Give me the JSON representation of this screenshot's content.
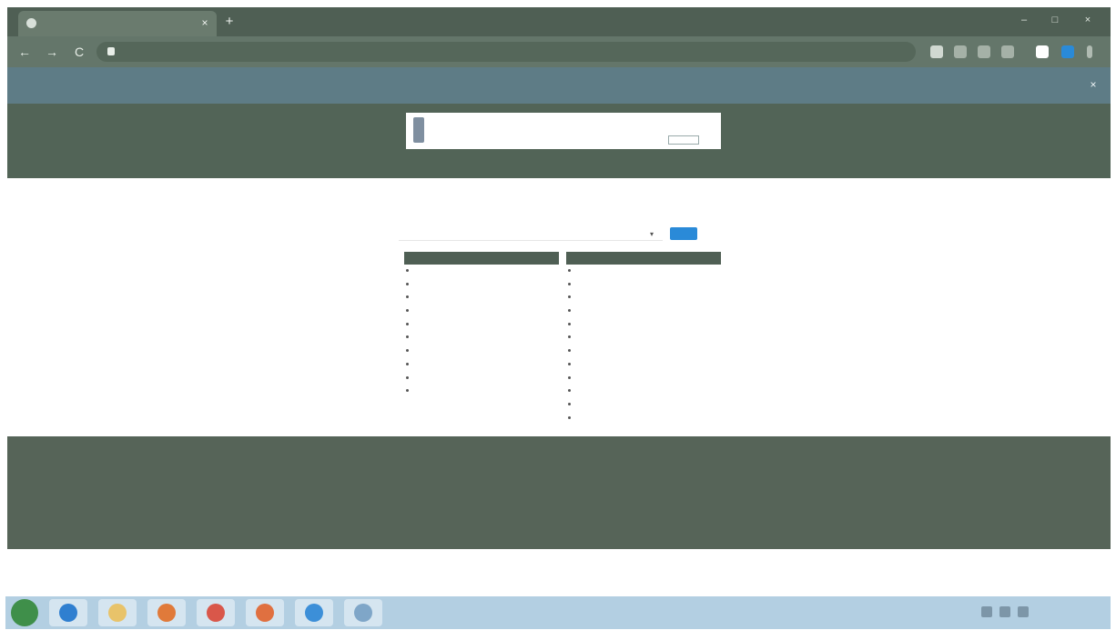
{
  "browser": {
    "tab_title": "",
    "tab_close": "×",
    "new_tab": "+",
    "window_controls": {
      "minimize": "–",
      "maximize": "□",
      "close": "×"
    },
    "nav": {
      "back": "←",
      "forward": "→",
      "reload": "C"
    },
    "url": "",
    "toolbar_icons": [
      "extension-icon",
      "star-icon",
      "extension-icon",
      "extension-icon",
      "extension-icon",
      "profile-icon",
      "menu-icon"
    ]
  },
  "infobar": {
    "message": "",
    "action_label": "",
    "close": "×"
  },
  "site": {
    "brand": "",
    "nav": [
      "",
      "",
      "",
      "",
      "",
      ""
    ],
    "breadcrumb_title": "",
    "breadcrumb_sub": ""
  },
  "content": {
    "heading": "",
    "subheading": "",
    "select_value": "",
    "caret": "▾",
    "go_label": ""
  },
  "panels": [
    {
      "header": "",
      "rows": [
        "",
        "",
        "",
        "",
        "",
        "",
        "",
        "",
        "",
        ""
      ]
    },
    {
      "header": "",
      "rows": [
        "",
        "",
        "",
        "",
        "",
        "",
        "",
        "",
        "",
        "",
        "",
        ""
      ]
    }
  ],
  "footer": {
    "columns": [
      {
        "heading": "",
        "items": [
          "",
          "",
          "",
          ""
        ]
      },
      {
        "heading": "",
        "items": [
          "",
          "",
          "",
          "",
          ""
        ]
      },
      {
        "heading": "",
        "items": [
          "",
          "",
          ""
        ]
      },
      {
        "heading": "",
        "items": [
          "",
          "",
          "",
          "",
          "",
          "",
          "",
          ""
        ]
      }
    ],
    "copyright": ""
  },
  "taskbar": {
    "apps": [
      "ie-icon",
      "folder-icon",
      "media-icon",
      "app-icon",
      "app-icon",
      "chrome-icon",
      "app-icon"
    ],
    "clock_time": "",
    "clock_date": ""
  },
  "colors": {
    "chrome_green": "#556659",
    "infobar_blue": "#5e7c86",
    "accent_blue": "#2a8ad8",
    "panel_header": "#4f5f54",
    "taskbar": "#b3cfe2"
  }
}
